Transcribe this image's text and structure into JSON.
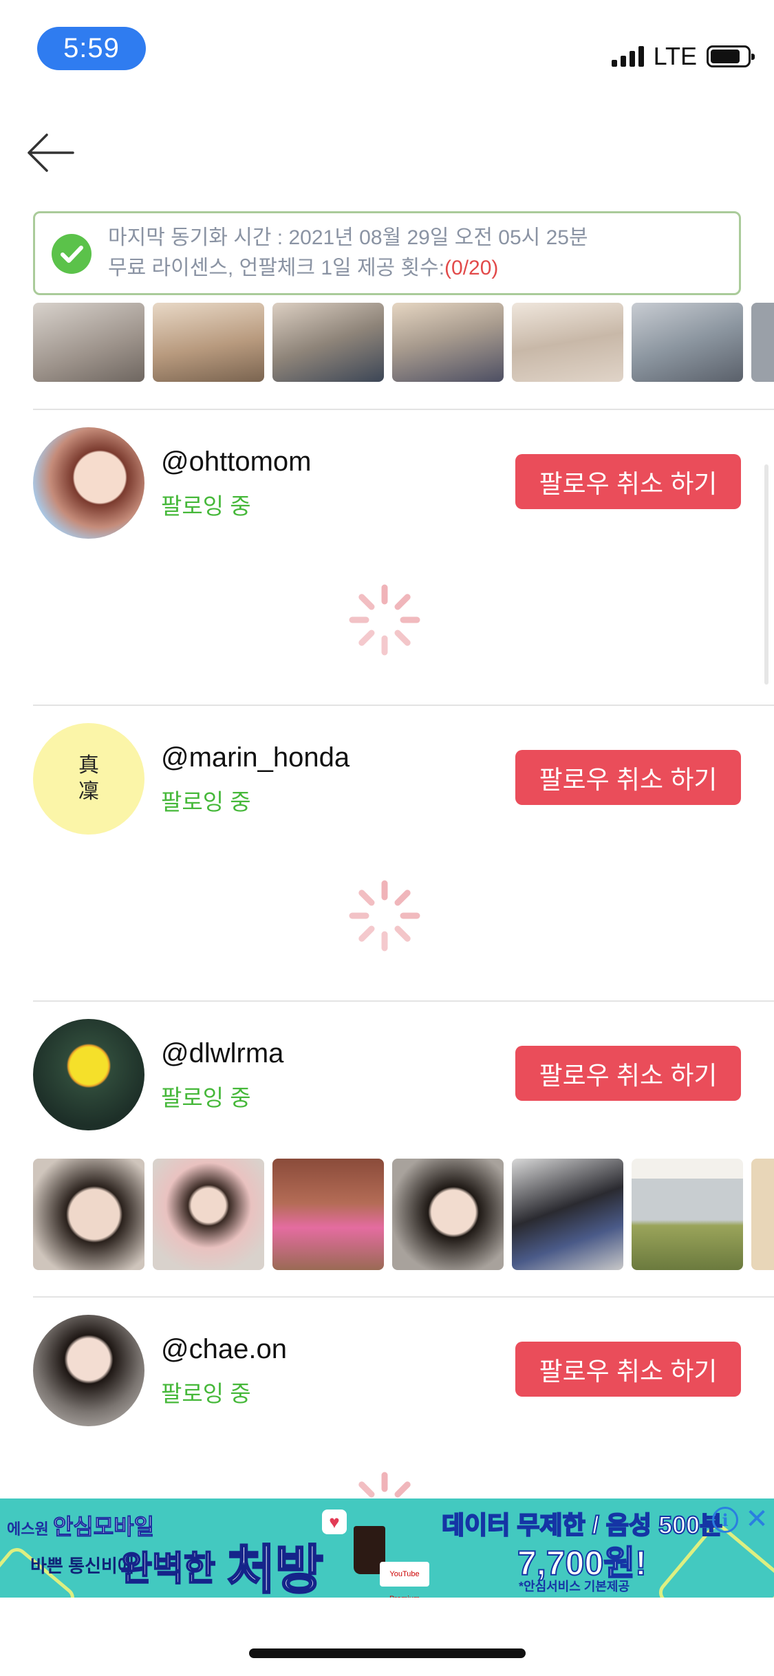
{
  "status_bar": {
    "time": "5:59",
    "network": "LTE"
  },
  "sync": {
    "line1": "마지막 동기화 시간 : 2021년 08월 29일 오전 05시 25분",
    "line2_prefix": "무료 라이센스, 언팔체크 1일 제공 횟수:",
    "line2_count": "(0/20)"
  },
  "users": [
    {
      "username": "@ohttomom",
      "status": "팔로잉 중",
      "button": "팔로우 취소 하기"
    },
    {
      "username": "@marin_honda",
      "status": "팔로잉 중",
      "button": "팔로우 취소 하기",
      "avatar_text": "真\n凜"
    },
    {
      "username": "@dlwlrma",
      "status": "팔로잉 중",
      "button": "팔로우 취소 하기"
    },
    {
      "username": "@chae.on",
      "status": "팔로잉 중",
      "button": "팔로우 취소 하기"
    }
  ],
  "ad": {
    "brand_small": "에스원",
    "brand": "안심모바일",
    "sub": "바쁜 통신비에",
    "headline": "완벽한",
    "headline_big": "처방",
    "offer": "데이터 무제한 / 음성 500분",
    "price": "7,700원!",
    "note": "*안심서비스 기본제공",
    "card_label": "YouTube Premium"
  },
  "colors": {
    "accent_green": "#46b83a",
    "button_red": "#ea4d5a",
    "time_pill": "#2f7cf0",
    "sync_count": "#e24a4a"
  },
  "icons": [
    "back-arrow-icon",
    "check-icon",
    "spinner-icon",
    "info-icon",
    "close-icon"
  ]
}
